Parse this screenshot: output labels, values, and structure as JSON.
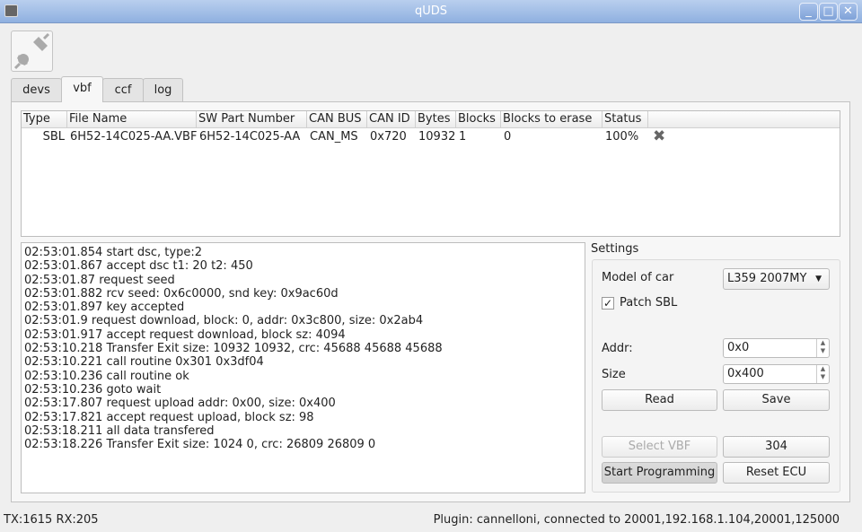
{
  "window": {
    "title": "qUDS"
  },
  "tabs": [
    {
      "label": "devs"
    },
    {
      "label": "vbf"
    },
    {
      "label": "ccf"
    },
    {
      "label": "log"
    }
  ],
  "table": {
    "columns": [
      "Type",
      "File Name",
      "SW Part Number",
      "CAN BUS",
      "CAN ID",
      "Bytes",
      "Blocks",
      "Blocks to erase",
      "Status"
    ],
    "rows": [
      {
        "type": "SBL",
        "file": "6H52-14C025-AA.VBF",
        "sw": "6H52-14C025-AA",
        "bus": "CAN_MS",
        "id": "0x720",
        "bytes": "10932",
        "blocks": "1",
        "erase": "0",
        "status": "100%",
        "remove_icon": "close-x-icon"
      }
    ]
  },
  "log": [
    "02:53:01.854 start dsc, type:2",
    "02:53:01.867 accept dsc t1: 20 t2: 450",
    "02:53:01.87 request seed",
    "02:53:01.882 rcv seed: 0x6c0000, snd key: 0x9ac60d",
    "02:53:01.897 key accepted",
    "02:53:01.9 request download, block: 0, addr: 0x3c800, size: 0x2ab4",
    "02:53:01.917 accept request download, block sz: 4094",
    "02:53:10.218 Transfer Exit size: 10932 10932, crc: 45688 45688 45688",
    "02:53:10.221 call routine 0x301 0x3df04",
    "02:53:10.236 call routine ok",
    "02:53:10.236 goto wait",
    "02:53:17.807 request upload addr: 0x00, size: 0x400",
    "02:53:17.821 accept request upload, block sz: 98",
    "02:53:18.211 all data transfered",
    "02:53:18.226 Transfer Exit size: 1024 0, crc: 26809 26809 0"
  ],
  "settings": {
    "title": "Settings",
    "model_label": "Model of car",
    "model_value": "L359 2007MY",
    "patch_label": "Patch SBL",
    "patch_checked": true,
    "addr_label": "Addr:",
    "addr_value": "0x0",
    "size_label": "Size",
    "size_value": "0x400",
    "read": "Read",
    "save": "Save",
    "select_vbf": "Select VBF",
    "counter": "304",
    "start": "Start Programming",
    "reset": "Reset ECU"
  },
  "status": {
    "left": "TX:1615 RX:205",
    "right": "Plugin: cannelloni, connected to 20001,192.168.1.104,20001,125000"
  }
}
